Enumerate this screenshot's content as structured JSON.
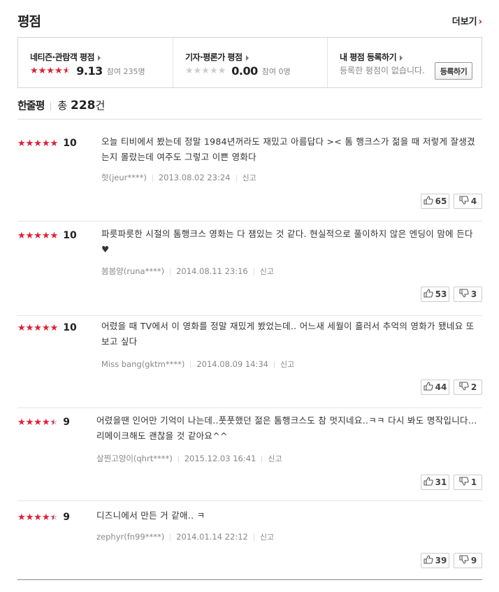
{
  "header": {
    "title": "평점",
    "more_label": "더보기"
  },
  "summary": {
    "netizen": {
      "label": "네티즌·관람객 평점",
      "score": "9.13",
      "participants": "참여 235명",
      "rating": 9.13
    },
    "critic": {
      "label": "기자·평론가 평점",
      "score": "0.00",
      "participants": "참여 0명",
      "rating": 0.0
    },
    "mine": {
      "label": "내 평점 등록하기",
      "text": "등록한 평점이 없습니다.",
      "button": "등록하기"
    }
  },
  "oneline": {
    "label": "한줄평",
    "total_prefix": "총",
    "count": "228",
    "suffix": "건"
  },
  "reviews": [
    {
      "score": "10",
      "rating": 10,
      "text": "오늘 티비에서 봤는데 정말 1984년꺼라도 재밌고 아름답다 >< 톰 행크스가 젊을 때 저렇게 잘생겼는지 몰랐는데 여주도 그렇고 이쁜 영화다",
      "user": "핫(jeur****)",
      "date": "2013.08.02 23:24",
      "report": "신고",
      "up": "65",
      "down": "4"
    },
    {
      "score": "10",
      "rating": 10,
      "text": "파릇파릇한 시절의 톰행크스 영화는 다 잼있는 것 같다. 현실적으로 풀이하지 않은 엔딩이 맘에 든다♥",
      "user": "봄봄양(runa****)",
      "date": "2014.08.11 23:16",
      "report": "신고",
      "up": "53",
      "down": "3"
    },
    {
      "score": "10",
      "rating": 10,
      "text": "어렸을 때 TV에서 이 영화를 정말 재밌게 봤었는데.. 어느새 세월이 흘러서 추억의 영화가 됐네요 또 보고 싶다",
      "user": "Miss bang(gktm****)",
      "date": "2014.08.09 14:34",
      "report": "신고",
      "up": "44",
      "down": "2"
    },
    {
      "score": "9",
      "rating": 9,
      "text": "어렸을땐 인어만 기억이 나는데..풋풋했던 젊은 톰행크스도 참 멋지네요..ㅋㅋ 다시 봐도 명작입니다...리메이크해도 괜찮을 것 같아요^^",
      "user": "살찐고양이(qhrt****)",
      "date": "2015.12.03 16:41",
      "report": "신고",
      "up": "31",
      "down": "1"
    },
    {
      "score": "9",
      "rating": 9,
      "text": "디즈니에서 만든 거 같애.. ㅋ",
      "user": "zephyr(fn99****)",
      "date": "2014.01.14 22:12",
      "report": "신고",
      "up": "39",
      "down": "9"
    }
  ],
  "colors": {
    "accent": "#e51e36",
    "star_off": "#cccccc"
  }
}
